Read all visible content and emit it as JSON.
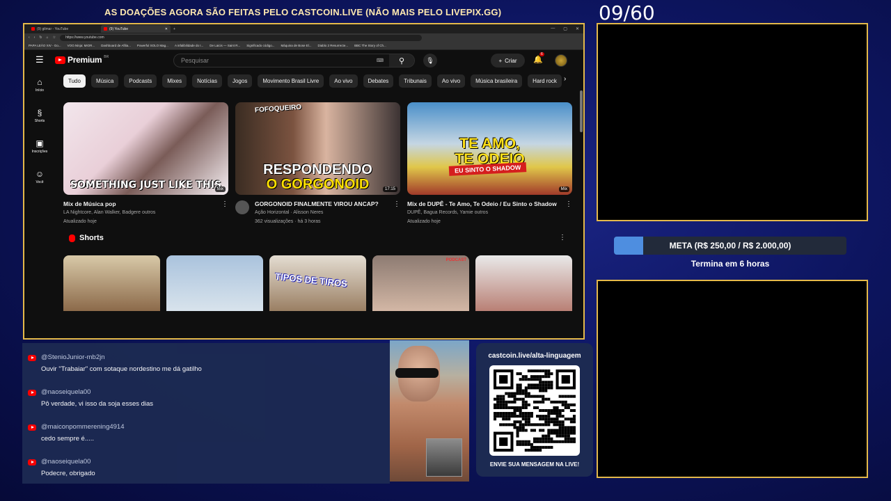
{
  "overlay": {
    "banner": "AS DOAÇÕES AGORA SÃO FEITAS PELO CASTCOIN.LIVE (NÃO MAIS PELO LIVEPIX.GG)",
    "counter": "09/60",
    "goal_text": "META (R$ 250,00 / R$ 2.000,00)",
    "goal_progress": 0.125,
    "goal_sub": "Termina em 6 horas",
    "qr_url": "castcoin.live/alta-linguagem",
    "qr_cta": "ENVIE SUA MENSAGEM NA LIVE!",
    "accent_border": "#e4b94a"
  },
  "browser": {
    "tabs": [
      {
        "label": "(9) gilmar - YouTube"
      },
      {
        "label": "(9) YouTube"
      }
    ],
    "new_tab": "+",
    "url": "https://www.youtube.com",
    "bookmarks": [
      "PAPA LEÃO XIV - Go...",
      "VOO.Ninja: MIOR...",
      "Dashboard de Afilia...",
      "Powerful SOLO Mag...",
      "A infalibilidade do I...",
      "De Laicis — Saint R...",
      "Significado código...",
      "Máquina de Bose El...",
      "Diablo 2 Resurrecte...",
      "BBC The Story of Ch..."
    ]
  },
  "youtube": {
    "logo": "Premium",
    "logo_region": "BR",
    "search_placeholder": "Pesquisar",
    "create_label": "Criar",
    "notif_count": "6",
    "sidebar": [
      {
        "label": "Início",
        "icon": "home-icon",
        "glyph": "⌂"
      },
      {
        "label": "Shorts",
        "icon": "shorts-icon",
        "glyph": "§"
      },
      {
        "label": "Inscrições",
        "icon": "subscriptions-icon",
        "glyph": "▣"
      },
      {
        "label": "Você",
        "icon": "profile-icon",
        "glyph": "☺"
      }
    ],
    "chips": [
      "Tudo",
      "Música",
      "Podcasts",
      "Mixes",
      "Notícias",
      "Jogos",
      "Movimento Brasil Livre",
      "Ao vivo",
      "Debates",
      "Tribunais",
      "Ao vivo",
      "Música brasileira",
      "Hard rock"
    ],
    "videos": [
      {
        "thumb_text": "SOMETHING JUST LIKE THIS",
        "badge": "Mix",
        "title": "Mix de Música pop",
        "meta1": "LA Nightcore, Alan Walker, Badgere outros",
        "meta2": "Atualizado hoje"
      },
      {
        "thumb_tag": "FOFOQUEIRO",
        "thumb_line1": "RESPONDENDO",
        "thumb_line2": "O GORGONOID",
        "badge": "17:15",
        "title": "GORGONOID FINALMENTE VIROU ANCAP?",
        "meta1": "Ação Horizontal · Alisson Neres",
        "meta2": "362 visualizações · há 3 horas"
      },
      {
        "thumb_line1": "TE AMO,",
        "thumb_line2": "TE ODEIO",
        "thumb_red": "EU SINTO O SHADOW",
        "badge": "Mix",
        "title": "Mix de DUPÊ - Te Amo, Te Odeio / Eu Sinto o Shadow",
        "meta1": "DUPÊ, Bagua Records, Yamie outros",
        "meta2": "Atualizado hoje"
      }
    ],
    "shorts_title": "Shorts",
    "shorts": [
      {
        "text": ""
      },
      {
        "text": ""
      },
      {
        "text": "TIPOS DE TIROS"
      },
      {
        "tag": "PODCAST"
      },
      {
        "text": ""
      }
    ]
  },
  "chat": [
    {
      "user": "@StenioJunior-mb2jn",
      "text": "Ouvir \"Trabaiar\" com sotaque nordestino me dá gatilho"
    },
    {
      "user": "@naoseiquela00",
      "text": "Pô verdade, vi isso da soja esses dias"
    },
    {
      "user": "@maiconpommerening4914",
      "text": "cedo sempre é....."
    },
    {
      "user": "@naoseiquela00",
      "text": "Podecre, obrigado"
    }
  ]
}
